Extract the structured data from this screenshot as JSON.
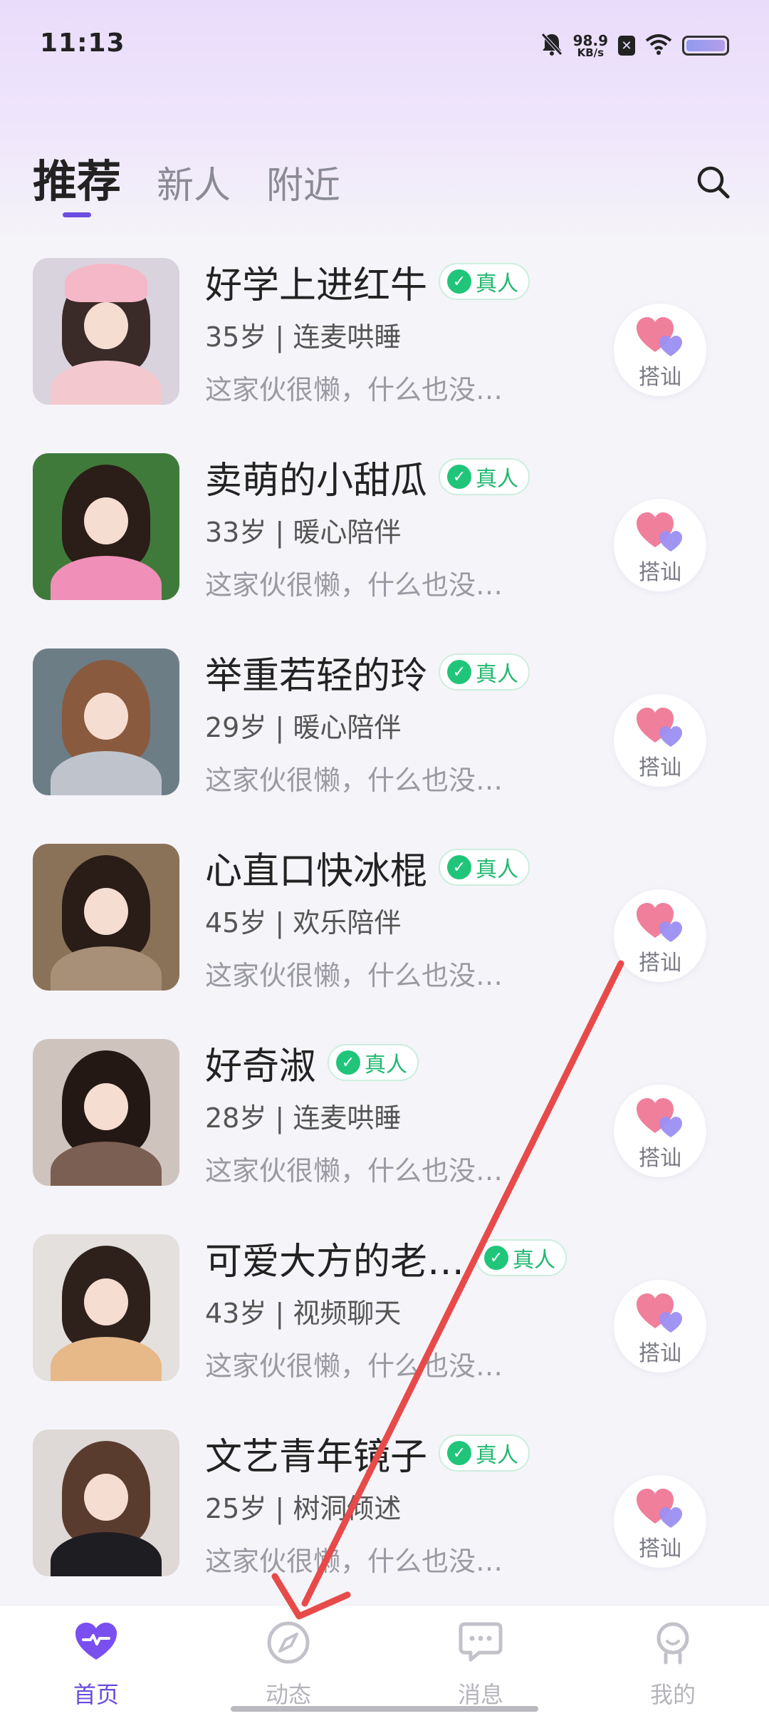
{
  "status_bar": {
    "time": "11:13",
    "net_speed_value": "98.9",
    "net_speed_unit": "KB/s",
    "icons": [
      "mute-bell-icon",
      "sim-disabled-icon",
      "wifi-icon",
      "battery-icon"
    ]
  },
  "header": {
    "tabs": [
      {
        "label": "推荐",
        "active": true
      },
      {
        "label": "新人",
        "active": false
      },
      {
        "label": "附近",
        "active": false
      }
    ],
    "search_icon": "search-icon"
  },
  "list": {
    "greet_label": "搭讪",
    "verified_label": "真人",
    "items": [
      {
        "name": "好学上进红牛",
        "meta": "35岁 | 连麦哄睡",
        "bio": "这家伙很懒，什么也没…",
        "hair": "#3a2a28",
        "bg": "#d8d3dc",
        "body": "#f3c9cf",
        "hat": "#f4b8c8"
      },
      {
        "name": "卖萌的小甜瓜",
        "meta": "33岁 | 暖心陪伴",
        "bio": "这家伙很懒，什么也没…",
        "hair": "#2b1d18",
        "bg": "#3f7a3b",
        "body": "#f08fb8",
        "hat": ""
      },
      {
        "name": "举重若轻的玲",
        "meta": "29岁 | 暖心陪伴",
        "bio": "这家伙很懒，什么也没…",
        "hair": "#8a5a3e",
        "bg": "#6c7d86",
        "body": "#bfc4cc",
        "hat": ""
      },
      {
        "name": "心直口快冰棍",
        "meta": "45岁 | 欢乐陪伴",
        "bio": "这家伙很懒，什么也没…",
        "hair": "#2a1c16",
        "bg": "#8a7258",
        "body": "#a88f77",
        "hat": ""
      },
      {
        "name": "好奇淑",
        "meta": "28岁 | 连麦哄睡",
        "bio": "这家伙很懒，什么也没…",
        "hair": "#241814",
        "bg": "#cfc3bd",
        "body": "#7b5f52",
        "hat": ""
      },
      {
        "name": "可爱大方的老…",
        "meta": "43岁 | 视频聊天",
        "bio": "这家伙很懒，什么也没…",
        "hair": "#2e211c",
        "bg": "#e3e0de",
        "body": "#e7b989",
        "hat": ""
      },
      {
        "name": "文艺青年镜子",
        "meta": "25岁 | 树洞倾述",
        "bio": "这家伙很懒，什么也没…",
        "hair": "#5a3c2f",
        "bg": "#ded8d6",
        "body": "#1d1d22",
        "hat": ""
      }
    ]
  },
  "bottom_nav": {
    "items": [
      {
        "label": "首页",
        "icon": "heart-pulse-icon",
        "active": true
      },
      {
        "label": "动态",
        "icon": "compass-icon",
        "active": false
      },
      {
        "label": "消息",
        "icon": "chat-bubble-icon",
        "active": false
      },
      {
        "label": "我的",
        "icon": "profile-icon",
        "active": false
      }
    ]
  },
  "colors": {
    "accent": "#6b4ce0",
    "verified": "#20c57a",
    "annotation": "#e84a4a"
  }
}
